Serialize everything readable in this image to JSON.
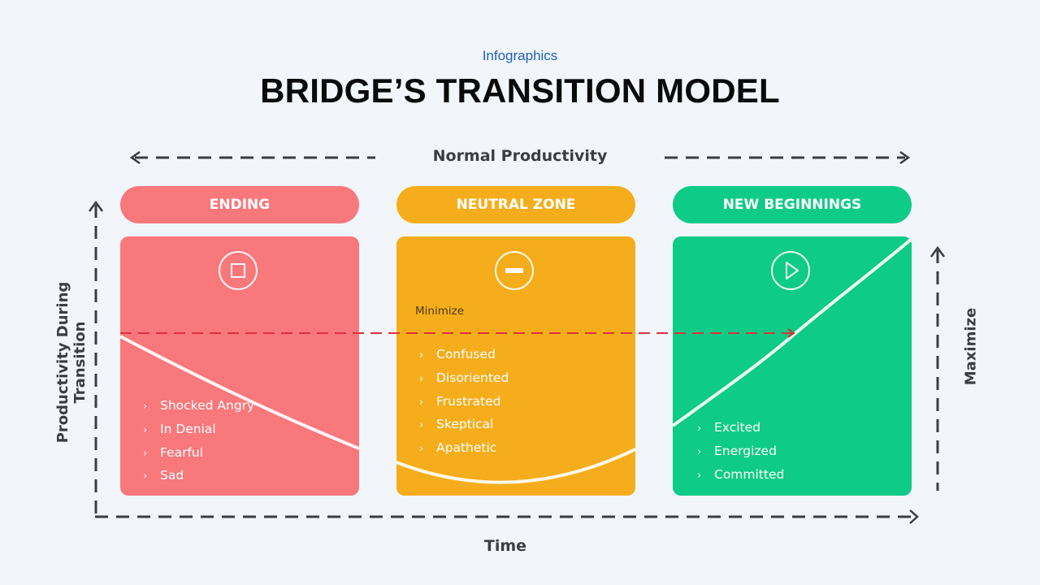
{
  "header": {
    "subtitle": "Infographics",
    "title": "BRIDGE’S TRANSITION MODEL"
  },
  "top_axis": {
    "label": "Normal Productivity"
  },
  "y_axis": {
    "label": "Productivity During Transition"
  },
  "x_axis": {
    "label": "Time"
  },
  "right_axis": {
    "label": "Maximize"
  },
  "colors": {
    "ending": "#f8787c",
    "neutral": "#f5ad1b",
    "new_beginnings": "#0ecb87",
    "axis": "#3a3d44",
    "reference_line": "#d9343a",
    "subtitle": "#1f5fbf"
  },
  "phases": [
    {
      "title": "ENDING",
      "icon": "stop-icon",
      "items": [
        "Shocked Angry",
        "In Denial",
        "Fearful",
        "Sad"
      ]
    },
    {
      "title": "NEUTRAL ZONE",
      "icon": "minus-icon",
      "note": "Minimize",
      "items": [
        "Confused",
        "Disoriented",
        "Frustrated",
        "Skeptical",
        "Apathetic"
      ]
    },
    {
      "title": "NEW BEGINNINGS",
      "icon": "play-icon",
      "items": [
        "Excited",
        "Energized",
        "Committed"
      ]
    }
  ],
  "bullet_glyph": "›"
}
